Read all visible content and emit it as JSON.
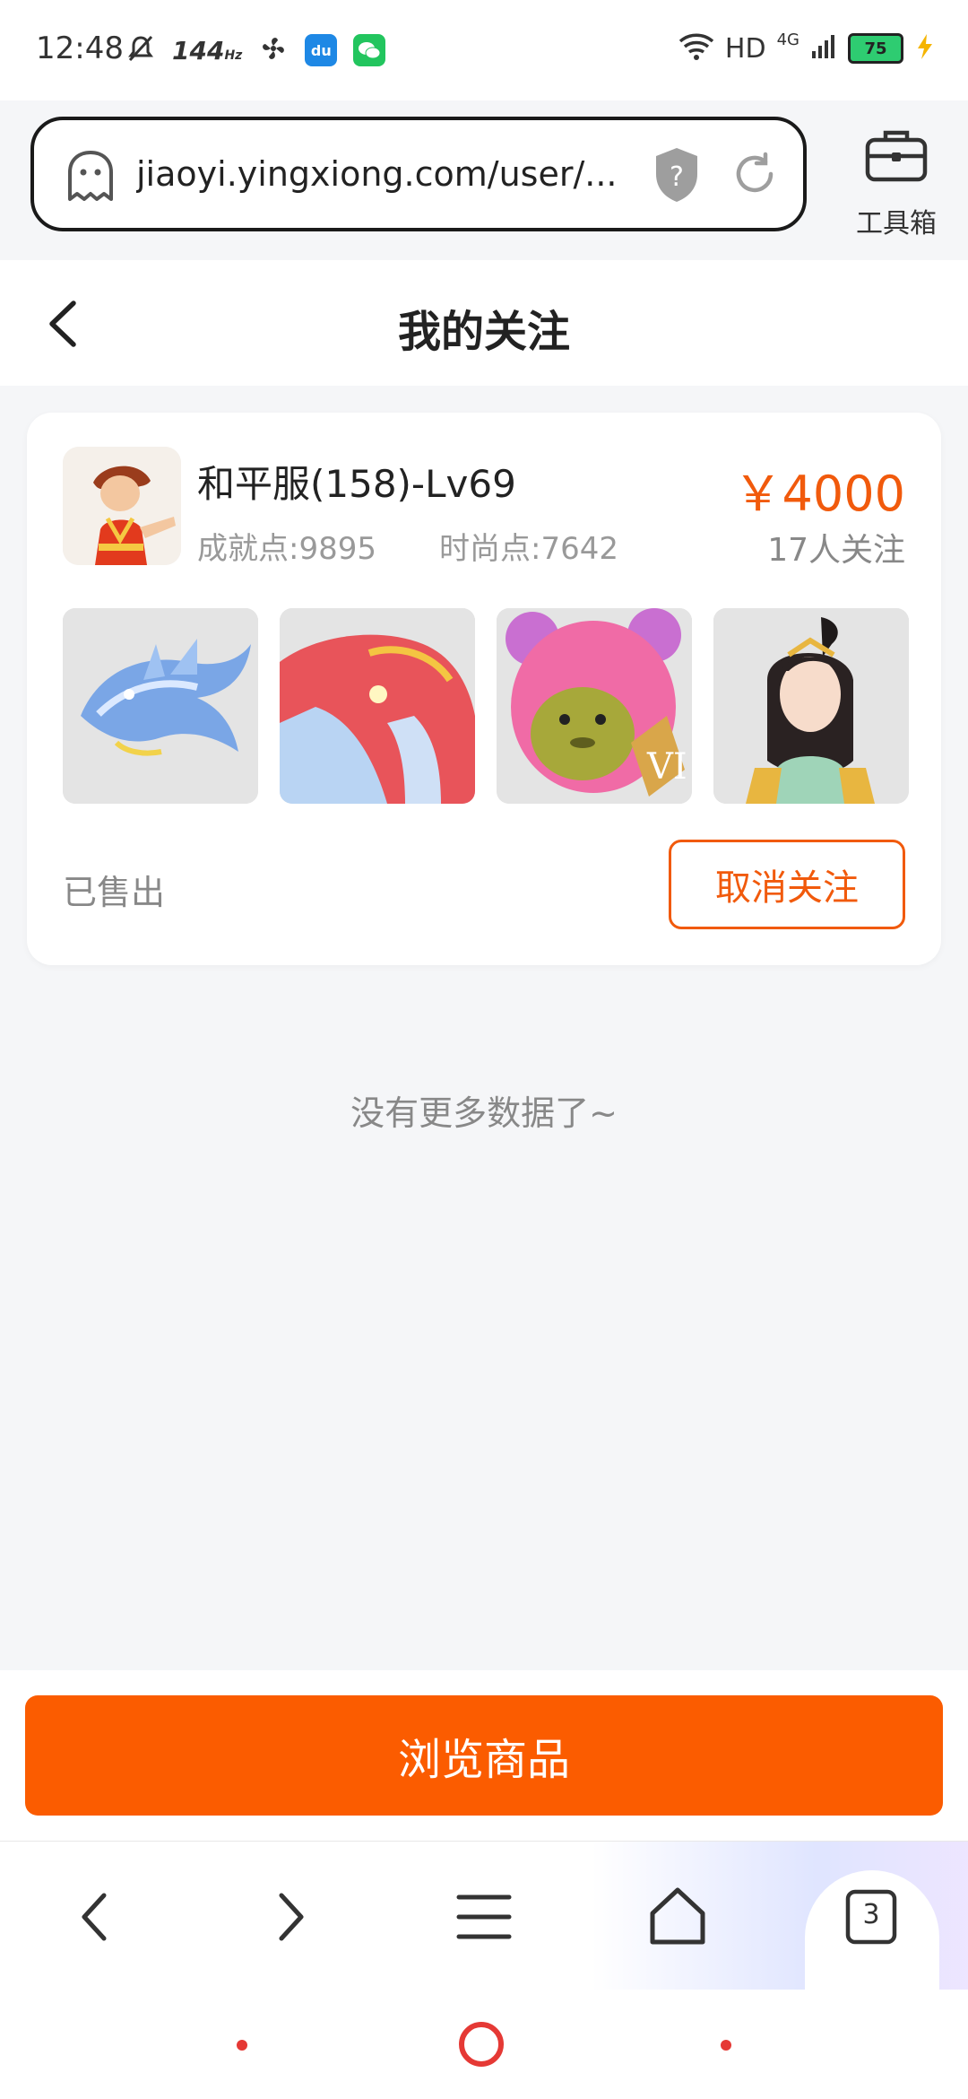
{
  "status_bar": {
    "time": "12:48",
    "refresh_rate": "144",
    "refresh_unit": "Hz",
    "network": "HD",
    "network_type": "4G",
    "battery": "75"
  },
  "browser": {
    "url": "jiaoyi.yingxiong.com/user/...",
    "toolbox_label": "工具箱",
    "tab_count": "3"
  },
  "page": {
    "title": "我的关注"
  },
  "listing": {
    "server_title": "和平服(158)-Lv69",
    "achievement": "成就点:9895",
    "fashion": "时尚点:7642",
    "price": "￥4000",
    "followers": "17人关注",
    "status": "已售出",
    "unfollow_label": "取消关注",
    "thumbnails": [
      "dragon-mount",
      "fish-mount",
      "pink-bear-outfit",
      "female-character"
    ]
  },
  "footer": {
    "no_more": "没有更多数据了~",
    "browse_label": "浏览商品"
  },
  "colors": {
    "accent": "#f15a0c",
    "button": "#fb5c00",
    "system_nav": "#e53935"
  }
}
